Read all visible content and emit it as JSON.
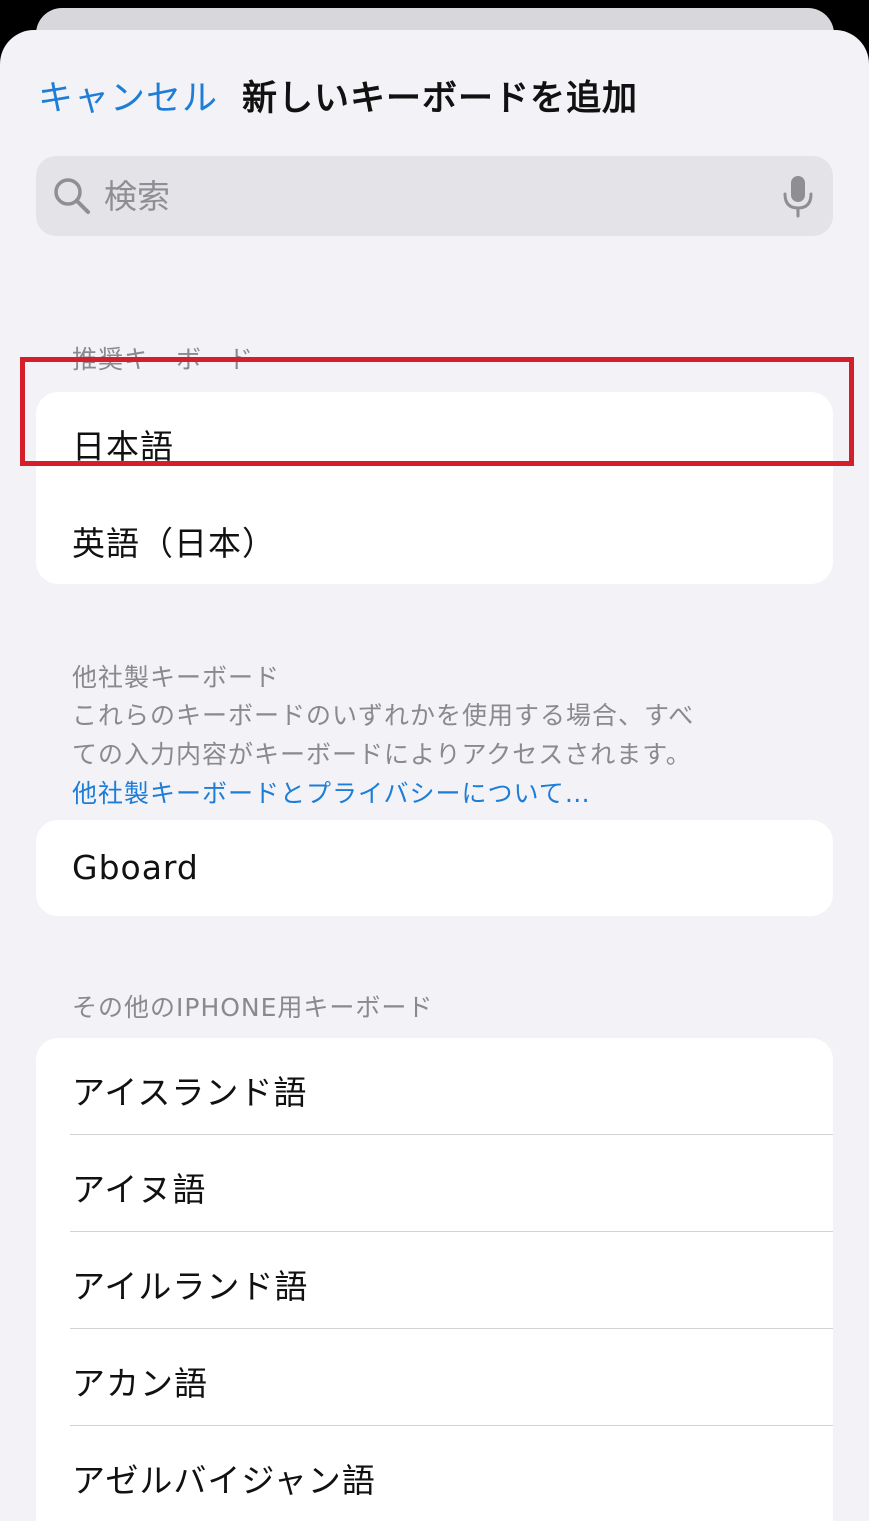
{
  "nav": {
    "cancel_label": "キャンセル",
    "title": "新しいキーボードを追加"
  },
  "search": {
    "placeholder": "検索",
    "value": ""
  },
  "suggested": {
    "header": "推奨キーボード",
    "items": [
      {
        "label": "日本語",
        "highlighted": true
      },
      {
        "label": "英語（日本）",
        "highlighted": false
      }
    ]
  },
  "third_party": {
    "header": "他社製キーボード",
    "description_line1": "これらのキーボードのいずれかを使用する場合、すべ",
    "description_line2": "ての入力内容がキーボードによりアクセスされます。",
    "link": "他社製キーボードとプライバシーについて…",
    "items": [
      {
        "label": "Gboard"
      }
    ]
  },
  "other": {
    "header": "その他のIPHONE用キーボード",
    "items": [
      {
        "label": "アイスランド語"
      },
      {
        "label": "アイヌ語"
      },
      {
        "label": "アイルランド語"
      },
      {
        "label": "アカン語"
      },
      {
        "label": "アゼルバイジャン語"
      }
    ]
  },
  "colors": {
    "accent": "#1e7dd7",
    "highlight": "#d41f2a",
    "background": "#f2f2f7"
  },
  "icons": {
    "search": "magnifying-glass",
    "mic": "microphone"
  }
}
